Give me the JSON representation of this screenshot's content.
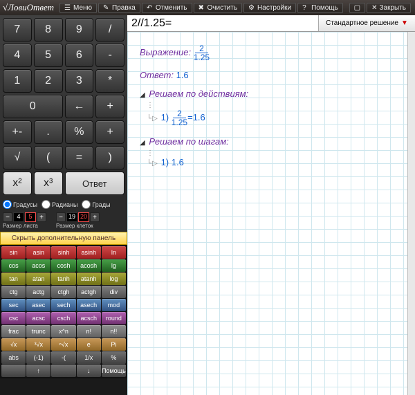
{
  "app": {
    "logo": "√ЛовиОтвет"
  },
  "menu": {
    "items": [
      "Меню",
      "Правка",
      "Отменить",
      "Очистить",
      "Настройки",
      "Помощь"
    ],
    "close": "Закрыть"
  },
  "keypad": {
    "r1": [
      "7",
      "8",
      "9",
      "/"
    ],
    "r2": [
      "4",
      "5",
      "6",
      "-"
    ],
    "r3": [
      "1",
      "2",
      "3",
      "*"
    ],
    "r4": [
      "0",
      "←",
      "+"
    ],
    "r5": [
      "+-",
      ".",
      "%",
      "+"
    ],
    "r6": [
      "√",
      "(",
      "=",
      ")"
    ],
    "r7": [
      "x²",
      "x³",
      "Ответ"
    ]
  },
  "anglemode": {
    "deg": "Градусы",
    "rad": "Радианы",
    "grad": "Грады"
  },
  "spin": {
    "sheet_label": "Размер листа",
    "sheet_a": "4",
    "sheet_b": "5",
    "cell_label": "Размер клеток",
    "cell_a": "19",
    "cell_b": "20"
  },
  "hidepanel": "Скрыть дополнительную панель",
  "func": {
    "rows": [
      [
        "sin",
        "asin",
        "sinh",
        "asinh",
        "ln"
      ],
      [
        "cos",
        "acos",
        "cosh",
        "acosh",
        "lg"
      ],
      [
        "tan",
        "atan",
        "tanh",
        "atanh",
        "log"
      ],
      [
        "ctg",
        "actg",
        "ctgh",
        "actgh",
        "div"
      ],
      [
        "sec",
        "asec",
        "sech",
        "asech",
        "mod"
      ],
      [
        "csc",
        "acsc",
        "csch",
        "acsch",
        "round"
      ],
      [
        "frac",
        "trunc",
        "x^n",
        "n!",
        "n!!"
      ],
      [
        "√x",
        "³√x",
        "ⁿ√x",
        "e",
        "Pi"
      ],
      [
        "abs",
        "(-1)",
        "-(",
        "1/x",
        "%"
      ]
    ],
    "bottom": [
      "",
      "↑",
      "",
      "↓",
      "Помощь"
    ]
  },
  "expr": {
    "value": "2//1.25="
  },
  "mode": {
    "label": "Стандартное решение"
  },
  "solution": {
    "expr_label": "Выражение:",
    "frac_top": "2",
    "frac_bot": "1.25",
    "ans_label": "Ответ:",
    "ans_val": "1.6",
    "sect1": "Решаем по действиям:",
    "step1_idx": "1)",
    "step1_res": "=1.6",
    "sect2": "Решаем по шагам:",
    "step2_idx": "1)",
    "step2_res": "1.6"
  }
}
